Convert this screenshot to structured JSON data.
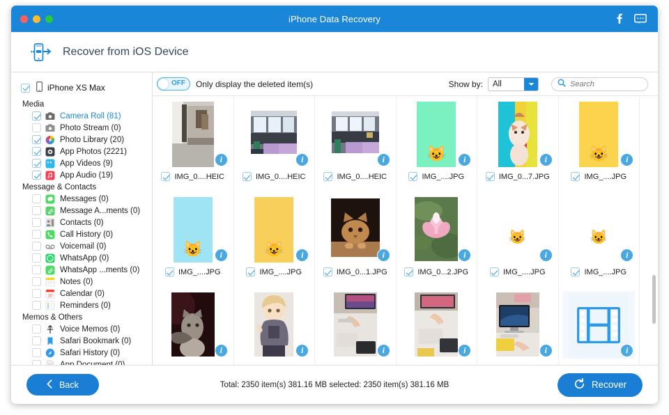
{
  "titlebar": {
    "title": "iPhone Data Recovery",
    "facebook_icon": "facebook-icon",
    "feedback_icon": "feedback-icon"
  },
  "header": {
    "title": "Recover from iOS Device",
    "icon": "phone-transfer-icon"
  },
  "sidebar": {
    "device": {
      "label": "iPhone XS Max",
      "checked": true
    },
    "groups": [
      {
        "title": "Media",
        "items": [
          {
            "label": "Camera Roll (81)",
            "checked": true,
            "active": true,
            "icon": "camera-roll-icon",
            "color": "#6a6a6a"
          },
          {
            "label": "Photo Stream (0)",
            "checked": false,
            "active": false,
            "icon": "photo-stream-icon",
            "color": "#8e8e8e"
          },
          {
            "label": "Photo Library (20)",
            "checked": true,
            "active": false,
            "icon": "photo-library-icon",
            "color": "#e04b8a"
          },
          {
            "label": "App Photos (2221)",
            "checked": true,
            "active": false,
            "icon": "app-photos-icon",
            "color": "#3a3f47"
          },
          {
            "label": "App Videos (9)",
            "checked": true,
            "active": false,
            "icon": "app-videos-icon",
            "color": "#2fb8f0"
          },
          {
            "label": "App Audio (19)",
            "checked": true,
            "active": false,
            "icon": "app-audio-icon",
            "color": "#fa3b4c"
          }
        ]
      },
      {
        "title": "Message & Contacts",
        "items": [
          {
            "label": "Messages (0)",
            "checked": false,
            "active": false,
            "icon": "messages-icon",
            "color": "#4cd964"
          },
          {
            "label": "Message A...ments (0)",
            "checked": false,
            "active": false,
            "icon": "message-attachments-icon",
            "color": "#5ad06c"
          },
          {
            "label": "Contacts (0)",
            "checked": false,
            "active": false,
            "icon": "contacts-icon",
            "color": "#9aa0a6"
          },
          {
            "label": "Call History (0)",
            "checked": false,
            "active": false,
            "icon": "call-history-icon",
            "color": "#4cd964"
          },
          {
            "label": "Voicemail (0)",
            "checked": false,
            "active": false,
            "icon": "voicemail-icon",
            "color": "#8e8e93"
          },
          {
            "label": "WhatsApp (0)",
            "checked": false,
            "active": false,
            "icon": "whatsapp-icon",
            "color": "#25d366"
          },
          {
            "label": "WhatsApp ...ments (0)",
            "checked": false,
            "active": false,
            "icon": "whatsapp-attachments-icon",
            "color": "#4cd964"
          },
          {
            "label": "Notes (0)",
            "checked": false,
            "active": false,
            "icon": "notes-icon",
            "color": "#ffd60a"
          },
          {
            "label": "Calendar (0)",
            "checked": false,
            "active": false,
            "icon": "calendar-icon",
            "color": "#ff3b30"
          },
          {
            "label": "Reminders (0)",
            "checked": false,
            "active": false,
            "icon": "reminders-icon",
            "color": "#34c759"
          }
        ]
      },
      {
        "title": "Memos & Others",
        "items": [
          {
            "label": "Voice Memos (0)",
            "checked": false,
            "active": false,
            "icon": "voice-memos-icon",
            "color": "#3a3a3c"
          },
          {
            "label": "Safari Bookmark (0)",
            "checked": false,
            "active": false,
            "icon": "safari-bookmark-icon",
            "color": "#2f9ae8"
          },
          {
            "label": "Safari History (0)",
            "checked": false,
            "active": false,
            "icon": "safari-history-icon",
            "color": "#2f9ae8"
          },
          {
            "label": "App Document (0)",
            "checked": false,
            "active": false,
            "icon": "app-document-icon",
            "color": "#c7c7cc"
          }
        ]
      }
    ]
  },
  "toolbar": {
    "toggle_state": "OFF",
    "toggle_on": false,
    "toggle_label": "Only display the deleted item(s)",
    "showby_label": "Show by:",
    "showby_value": "All",
    "search_placeholder": "Search",
    "search_value": "",
    "search_icon": "search-icon",
    "dropdown_icon": "chevron-down-icon"
  },
  "grid": {
    "rows": [
      [
        {
          "name": "IMG_0....HEIC",
          "checked": true,
          "type": "photo",
          "kind": "corridor",
          "bg": "#cfcbc6"
        },
        {
          "name": "IMG_0....HEIC",
          "checked": true,
          "type": "photo",
          "kind": "office",
          "bg": "#8d93a0"
        },
        {
          "name": "IMG_0....HEIC",
          "checked": true,
          "type": "photo",
          "kind": "office2",
          "bg": "#7f8794"
        },
        {
          "name": "IMG_....JPG",
          "checked": true,
          "type": "photo",
          "kind": "doodle-green",
          "bg": "#7bf0c0"
        },
        {
          "name": "IMG_0...7.JPG",
          "checked": true,
          "type": "photo",
          "kind": "cat-color",
          "bg": "#f2d23a"
        },
        {
          "name": "IMG_....JPG",
          "checked": true,
          "type": "photo",
          "kind": "doodle-yellow",
          "bg": "#fbd34d"
        }
      ],
      [
        {
          "name": "IMG_....JPG",
          "checked": true,
          "type": "photo",
          "kind": "doodle-cyan",
          "bg": "#9fe4f5"
        },
        {
          "name": "IMG_....JPG",
          "checked": true,
          "type": "photo",
          "kind": "doodle-amber",
          "bg": "#f8cf5a"
        },
        {
          "name": "IMG_0...1.JPG",
          "checked": true,
          "type": "photo",
          "kind": "cat-dark",
          "bg": "#2a1a12"
        },
        {
          "name": "IMG_0...2.JPG",
          "checked": true,
          "type": "photo",
          "kind": "lotus",
          "bg": "#5d7c4e"
        },
        {
          "name": "IMG_....JPG",
          "checked": true,
          "type": "photo",
          "kind": "doodle-white",
          "bg": "#ffffff"
        },
        {
          "name": "IMG_....JPG",
          "checked": true,
          "type": "photo",
          "kind": "doodle-pink",
          "bg": "#ffffff"
        }
      ],
      [
        {
          "name": "",
          "checked": false,
          "type": "photo",
          "kind": "cat-night",
          "bg": "#2b0f12"
        },
        {
          "name": "",
          "checked": false,
          "type": "photo",
          "kind": "anime",
          "bg": "#e8e2de"
        },
        {
          "name": "",
          "checked": false,
          "type": "photo",
          "kind": "desk",
          "bg": "#d7d2cc"
        },
        {
          "name": "",
          "checked": false,
          "type": "photo",
          "kind": "desk2",
          "bg": "#cfc9c2"
        },
        {
          "name": "",
          "checked": false,
          "type": "photo",
          "kind": "imac",
          "bg": "#d6d0c8"
        },
        {
          "name": "",
          "checked": false,
          "type": "video",
          "kind": "film",
          "bg": "#eef6fc"
        }
      ]
    ],
    "info_badge_icon": "info-icon",
    "video_icon": "film-strip-icon"
  },
  "footer": {
    "back_label": "Back",
    "back_icon": "chevron-left-icon",
    "status": "Total: 2350 item(s) 381.16 MB   selected: 2350 item(s) 381.16 MB",
    "recover_label": "Recover",
    "recover_icon": "restore-icon"
  },
  "colors": {
    "accent": "#1a86d8",
    "button": "#1a7fd4",
    "link": "#1a86d8"
  }
}
